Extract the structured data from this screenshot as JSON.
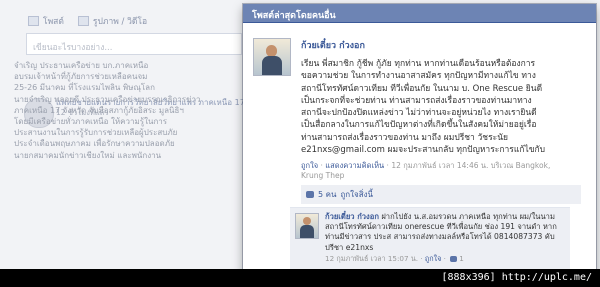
{
  "background": {
    "tabs": [
      {
        "label": "โพสต์"
      },
      {
        "label": "รูปภาพ / วิดีโอ"
      }
    ],
    "composer_placeholder": "เขียนอะไรบางอย่าง...",
    "post": {
      "author": "แพทย์ชายแดนรายการวิทยาลัยวิทยาแพร่ ภาคเหนือ 17",
      "time": "12 ชั่วโมงที่แล้ว",
      "lines": [
        "จำเริญ ประธานเครือข่าย บก.ภาคเหนือ",
        "อบรมเจ้าหน้าที่กู้ภัยการช่วยเหลือคนจม",
        "25-26 มีนาคม ที่โรงแรมไพลิน พิษณุโลก",
        "นายจำเริญ พลอยดี ประธานเครือข่ายบรรณาธิการข่าว",
        "ภาคเหนือ 17 จังหวัด จับมือสภากู้ภัยอิสระ มูลนิธิฯ",
        "โดยมีเครือข่ายทั่วภาคเหนือ ให้ความรู้ในการ",
        "ประสานงานในการรู้รับการช่วยเหลือผู้ประสบภัย",
        "ประจำเดือนพฤษภาคม เพื่อรักษาความปลอดภัย",
        "นายกสมาคมนักข่าวเชียงใหม่ และพนักงาน"
      ]
    }
  },
  "overlay": {
    "header_title": "โพสต์ล่าสุดโดยคนอื่น",
    "post": {
      "author": "ก้วยเตี๋ยว ก๋วงอก",
      "text_lines": [
        "เรียน พี่สมาชิก กู้ชีพ กู้ภัย ทุกท่าน หากท่านเดือนร้อนหรือต้องการ",
        "ขอความช่วย ในการทำงานอาสาสมัคร ทุกปัญหามีทางแก้ไข ทาง",
        "สถานีโทรทัศน์ดาวเทียม ทีวีเพื่อนกัย ในนาม บ. One Rescue ยินดี",
        "เป็นกระจกที่จะช่วยท่าน ท่านสามารถส่งเรื่องราวของท่านมาทาง",
        "สถานีจะปกป้องปิดแหล่งข่าว ไม่ว่าท่านจะอยู่หน่วยไง ทางเรายินดี",
        "เป็นสื่อกลางในการแก้ไขปัญหาต่างที่เกิดขึ้นในสังคมให้ม่ายอยู่เรื่อ",
        "ท่านสามารถส่งเรื่องราวของท่าน มาถึง ผมปรีชา วัชระนัย",
        "e21nxs@gmail.com ผมจะประสานกลับ ทุกปัญหาระการแก้ไขกับ"
      ],
      "meta": {
        "like_label": "ถูกใจ",
        "sep": " · ",
        "attachment_label": "แสดงความคิดเห็น",
        "timestamp": "12 กุมภาพันธ์ เวลา 14:46 น. บริเวณ Bangkok,",
        "location": "Krung Thep"
      },
      "likes_summary": "5 คน",
      "likes_suffix": "ถูกใจสิ่งนี้"
    },
    "comment": {
      "author": "ก้วยเตี๋ยว ก๋วงอก",
      "text": "ฝากไปยัง น.ส.อมรวดน ภาคเหนือ ทุกท่าน ผม/ในนามสถานีโทรทัศน์ดาวเทียม onerescue ทีวีเพื่อนกัย ช่อง 191 จานดำ หากท่านมีข่าวสาร ประส สามารถส่งทางมลล์หรือโทรได้ 0814087373 คับ ปรีชา e21nxs",
      "timestamp": "12 กุมภาพันธ์ เวลา 15:07 น.",
      "like_label": "ถูกใจ",
      "like_count": "1"
    }
  },
  "footer_band": "[888x396] http://uplc.me/"
}
